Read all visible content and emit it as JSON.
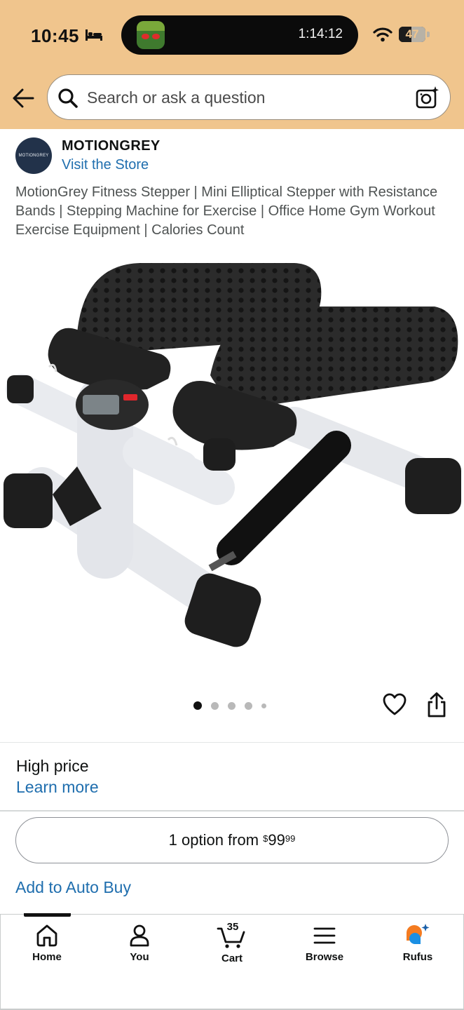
{
  "status_bar": {
    "time": "10:45",
    "timer": "1:14:12",
    "battery": "47"
  },
  "search": {
    "placeholder": "Search or ask a question"
  },
  "store": {
    "logo_text": "MOTIONGREY",
    "name": "MOTIONGREY",
    "link": "Visit the Store"
  },
  "product": {
    "title": "MotionGrey Fitness Stepper | Mini Elliptical Stepper with Resistance Bands | Stepping Machine for Exercise | Office Home Gym Workout Exercise Equipment | Calories Count",
    "image_count": 5,
    "active_image": 1
  },
  "pricing": {
    "label": "High price",
    "learn_more": "Learn more",
    "option_prefix": "1 option from ",
    "currency": "$",
    "dollars": "99",
    "cents": "99",
    "auto_buy": "Add to Auto Buy"
  },
  "nav": {
    "home": "Home",
    "you": "You",
    "cart": "Cart",
    "cart_count": "35",
    "browse": "Browse",
    "rufus": "Rufus"
  },
  "colors": {
    "header_bg": "#f0c58d",
    "link": "#1f6eae",
    "rufus_orange": "#f47b20",
    "rufus_blue": "#1a8fe3"
  }
}
